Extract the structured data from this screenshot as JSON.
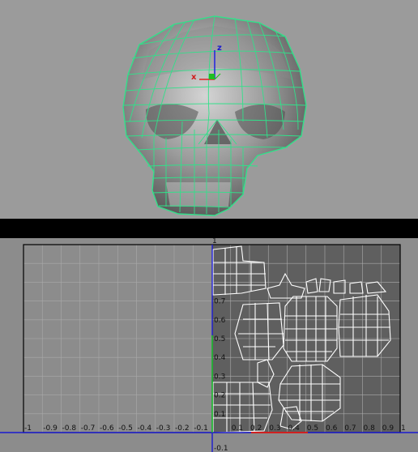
{
  "viewport": {
    "object": "skull-mesh",
    "wire_color": "#32e08a",
    "background": "#9b9b9b",
    "manipulator": {
      "x_label": "x",
      "z_label": "z",
      "x_color": "#e02020",
      "y_color": "#20c020",
      "z_color": "#2020e0"
    }
  },
  "uv_editor": {
    "background": "#8c8c8c",
    "uv_space_color": "#5f5f5f",
    "grid_color": "#aaaaaa",
    "u_axis_color": "#1a1ad0",
    "v_axis_color": "#20c020",
    "shell_color": "#ffffff",
    "x_ticks": [
      "-1",
      "-0.9",
      "-0.8",
      "-0.7",
      "-0.6",
      "-0.5",
      "-0.4",
      "-0.3",
      "-0.2",
      "-0.1",
      "0.1",
      "0.2",
      "0.3",
      "0.4",
      "0.5",
      "0.6",
      "0.7",
      "0.8",
      "0.9",
      "1"
    ],
    "y_ticks": [
      "0.1",
      "0.2",
      "0.3",
      "0.4",
      "0.5",
      "0.6",
      "0.7"
    ],
    "below_tick": "-0.1",
    "top_tick": "1"
  }
}
